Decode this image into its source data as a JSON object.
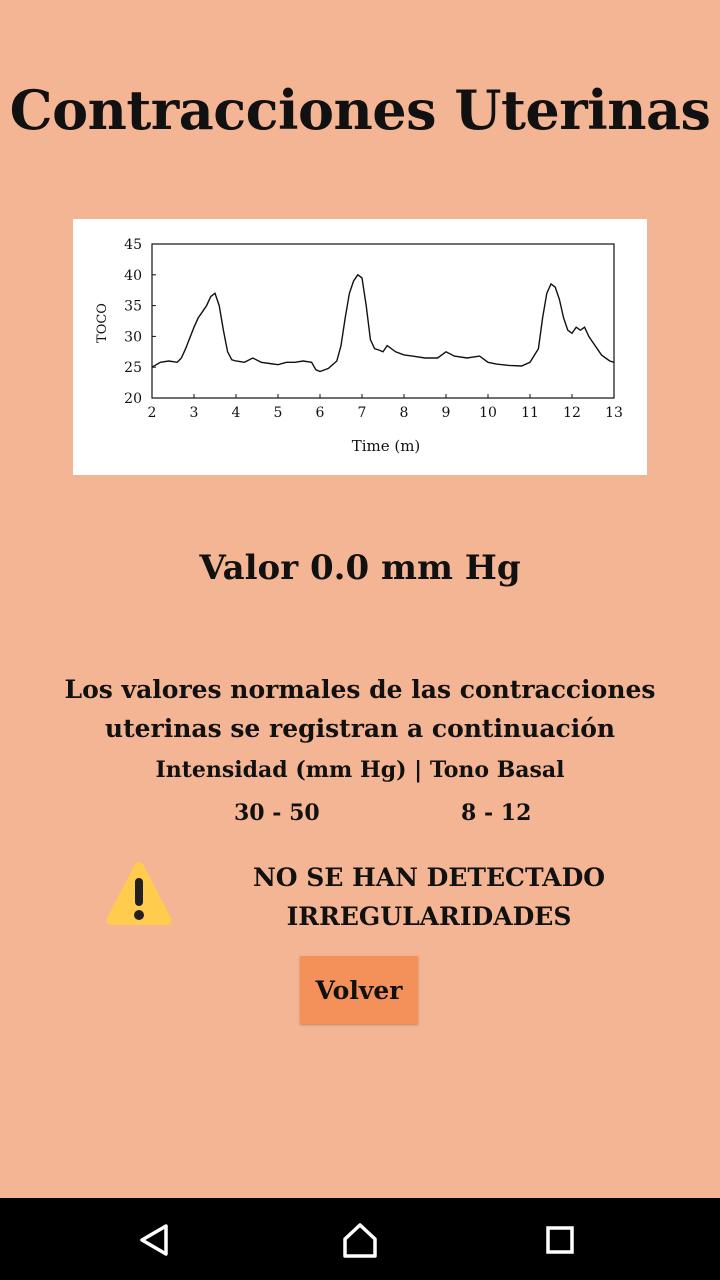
{
  "title": "Contracciones Uterinas",
  "valor_text": "Valor 0.0 mm Hg",
  "info_text": "Los valores normales de las contracciones uterinas se registran a continuación",
  "table_header": "Intensidad (mm Hg) | Tono Basal",
  "intensidad_range": "30 - 50",
  "tono_basal_range": "8 - 12",
  "alert_text": "NO SE HAN DETECTADO IRREGULARIDADES",
  "volver_label": "Volver",
  "colors": {
    "background": "#f4b594",
    "button": "#f4905a",
    "warning": "#ffcc4d"
  },
  "icons": {
    "alert": "warning-icon",
    "nav_back": "back-triangle-icon",
    "nav_home": "home-icon",
    "nav_recents": "recents-square-icon"
  },
  "chart_data": {
    "type": "line",
    "xlabel": "Time (m)",
    "ylabel": "TOCO",
    "xlim": [
      2,
      13
    ],
    "ylim": [
      20,
      45
    ],
    "x_ticks": [
      "2",
      "3",
      "4",
      "5",
      "6",
      "7",
      "8",
      "9",
      "10",
      "11",
      "12",
      "13"
    ],
    "y_ticks": [
      "20",
      "25",
      "30",
      "35",
      "40",
      "45"
    ],
    "series": [
      {
        "x": [
          2.0,
          2.2,
          2.4,
          2.6,
          2.7,
          2.8,
          3.0,
          3.1,
          3.2,
          3.3,
          3.4,
          3.5,
          3.6,
          3.7,
          3.8,
          3.9,
          4.0,
          4.2,
          4.4,
          4.6,
          4.8,
          5.0,
          5.2,
          5.4,
          5.6,
          5.8,
          5.9,
          6.0,
          6.2,
          6.4,
          6.5,
          6.6,
          6.7,
          6.8,
          6.9,
          7.0,
          7.1,
          7.2,
          7.3,
          7.4,
          7.5,
          7.6,
          7.8,
          8.0,
          8.2,
          8.5,
          8.8,
          9.0,
          9.2,
          9.5,
          9.8,
          10.0,
          10.2,
          10.5,
          10.8,
          11.0,
          11.2,
          11.3,
          11.4,
          11.5,
          11.6,
          11.7,
          11.8,
          11.9,
          12.0,
          12.1,
          12.2,
          12.3,
          12.4,
          12.5,
          12.6,
          12.7,
          12.8,
          12.9,
          13.0
        ],
        "y": [
          25.0,
          25.8,
          26.0,
          25.8,
          26.5,
          28.0,
          31.5,
          33.0,
          34.0,
          35.0,
          36.5,
          37.0,
          35.0,
          31.0,
          27.5,
          26.2,
          26.0,
          25.8,
          26.5,
          25.8,
          25.6,
          25.4,
          25.8,
          25.8,
          26.0,
          25.8,
          24.6,
          24.3,
          24.8,
          26.0,
          28.5,
          33.0,
          37.0,
          39.0,
          40.0,
          39.5,
          35.0,
          29.5,
          28.0,
          27.8,
          27.5,
          28.5,
          27.5,
          27.0,
          26.8,
          26.5,
          26.5,
          27.5,
          26.8,
          26.5,
          26.8,
          25.8,
          25.5,
          25.3,
          25.2,
          25.8,
          28.0,
          33.0,
          37.0,
          38.5,
          38.0,
          36.0,
          33.0,
          31.0,
          30.5,
          31.5,
          31.0,
          31.5,
          30.0,
          29.0,
          28.0,
          27.0,
          26.5,
          26.0,
          25.8
        ]
      }
    ]
  }
}
